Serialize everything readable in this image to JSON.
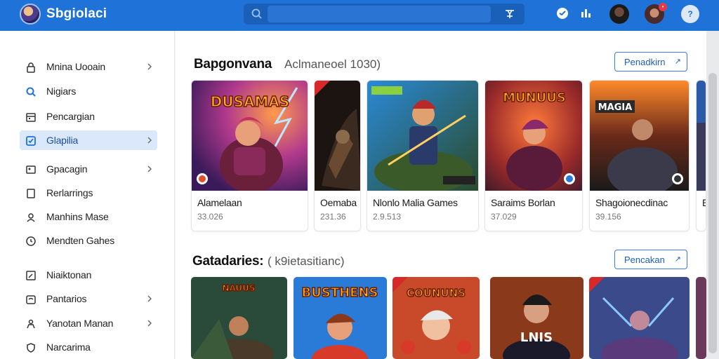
{
  "app": {
    "title": "Sbgiolaci"
  },
  "search": {
    "placeholder": ""
  },
  "sidebar": {
    "items": [
      {
        "label": "Mnina Uooain",
        "icon": "lock-icon",
        "chevron": true
      },
      {
        "label": "Nigiars",
        "icon": "search-icon",
        "chevron": false
      },
      {
        "label": "Pencargian",
        "icon": "calendar-icon",
        "chevron": false
      },
      {
        "label": "Glapilia",
        "icon": "checkbox-icon",
        "chevron": true,
        "active": true
      },
      {
        "label": "Gpacagin",
        "icon": "image-icon",
        "chevron": true
      },
      {
        "label": "Rerlarrings",
        "icon": "square-icon",
        "chevron": false
      },
      {
        "label": "Manhins Mase",
        "icon": "user-icon",
        "chevron": false
      },
      {
        "label": "Mendten Gahes",
        "icon": "clock-icon",
        "chevron": false
      },
      {
        "label": "Niaiktonan",
        "icon": "edit-icon",
        "chevron": false
      },
      {
        "label": "Pantarios",
        "icon": "gift-icon",
        "chevron": true
      },
      {
        "label": "Yanotan Manan",
        "icon": "person-icon",
        "chevron": true
      },
      {
        "label": "Narcarima",
        "icon": "shield-icon",
        "chevron": false
      }
    ]
  },
  "section1": {
    "title": "Bapgonvana",
    "subtitle": "Aclmaneoel  1030)",
    "button": "Penadkirn",
    "cards": [
      {
        "title": "Alamelaan",
        "meta": "33.026",
        "art_text": "DUSAMAS"
      },
      {
        "title": "Oemaba",
        "meta": "231.36",
        "art_text": ""
      },
      {
        "title": "Nlonlo Malia Games",
        "meta": "2.9.513",
        "art_text": ""
      },
      {
        "title": "Saraims Borlan",
        "meta": "37.029",
        "art_text": "MUNUUS"
      },
      {
        "title": "Shagoionecdinac",
        "meta": "39.156",
        "art_text": "MAGIA"
      },
      {
        "title": "E",
        "meta": "",
        "art_text": ""
      }
    ]
  },
  "section2": {
    "title": "Gatadaries:",
    "subtitle": "( k9ietasitianc)",
    "button": "Pencakan",
    "cards": [
      {
        "art_text": "NAUUS"
      },
      {
        "art_text": "BUSTHENS"
      },
      {
        "art_text": "COUNUNS"
      },
      {
        "art_text": "LNIS"
      },
      {
        "art_text": ""
      },
      {
        "art_text": ""
      }
    ]
  },
  "colors": {
    "topbar": "#1f72d8",
    "accent": "#3a7fd6",
    "active_bg": "#dbe8fb"
  }
}
